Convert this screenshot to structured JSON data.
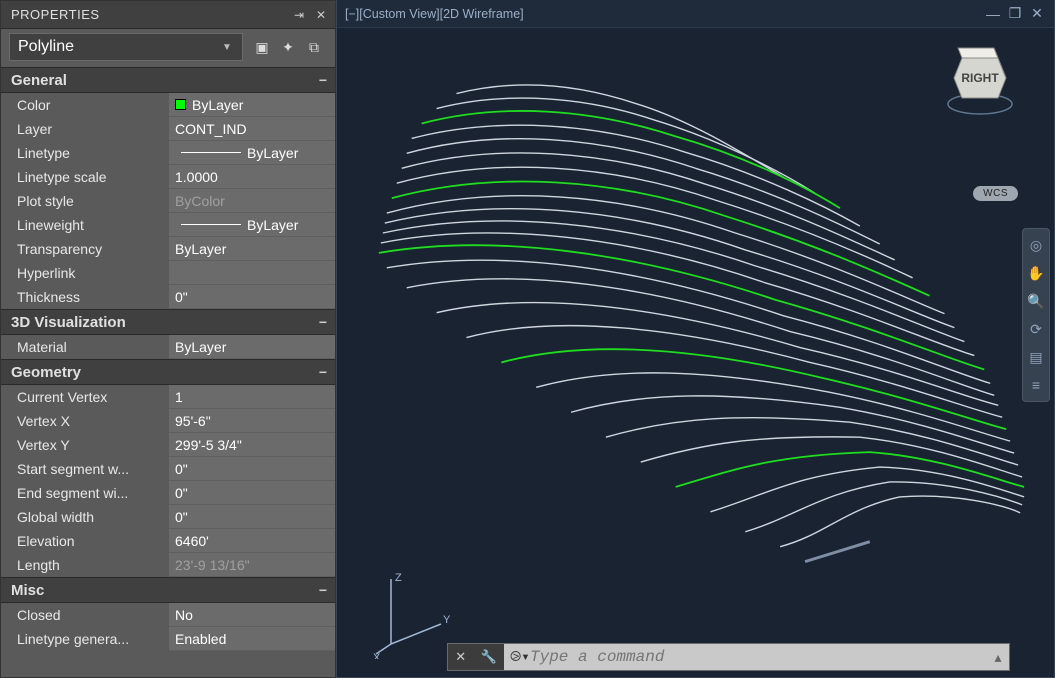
{
  "panel": {
    "title": "PROPERTIES",
    "selector": "Polyline"
  },
  "sections": {
    "general": {
      "title": "General",
      "color_label": "Color",
      "color_value": "ByLayer",
      "layer_label": "Layer",
      "layer_value": "CONT_IND",
      "linetype_label": "Linetype",
      "linetype_value": "ByLayer",
      "ltscale_label": "Linetype scale",
      "ltscale_value": "1.0000",
      "plotstyle_label": "Plot style",
      "plotstyle_value": "ByColor",
      "lineweight_label": "Lineweight",
      "lineweight_value": "ByLayer",
      "transp_label": "Transparency",
      "transp_value": "ByLayer",
      "hyper_label": "Hyperlink",
      "hyper_value": "",
      "thick_label": "Thickness",
      "thick_value": "0\""
    },
    "viz": {
      "title": "3D Visualization",
      "material_label": "Material",
      "material_value": "ByLayer"
    },
    "geom": {
      "title": "Geometry",
      "cv_label": "Current Vertex",
      "cv_value": "1",
      "vx_label": "Vertex X",
      "vx_value": "95'-6\"",
      "vy_label": "Vertex Y",
      "vy_value": "299'-5 3/4\"",
      "ssw_label": "Start segment w...",
      "ssw_value": "0\"",
      "esw_label": "End segment wi...",
      "esw_value": "0\"",
      "gw_label": "Global width",
      "gw_value": "0\"",
      "elev_label": "Elevation",
      "elev_value": "6460'",
      "len_label": "Length",
      "len_value": "23'-9 13/16\""
    },
    "misc": {
      "title": "Misc",
      "closed_label": "Closed",
      "closed_value": "No",
      "ltg_label": "Linetype genera...",
      "ltg_value": "Enabled"
    }
  },
  "viewport": {
    "title_left": "[−][Custom View][2D Wireframe]",
    "wcs": "WCS",
    "viewcube_face": "RIGHT"
  },
  "axis": {
    "z": "Z",
    "y": "Y",
    "x": "X"
  },
  "cmd": {
    "prompt": "⧁▾",
    "placeholder": "Type a command"
  }
}
